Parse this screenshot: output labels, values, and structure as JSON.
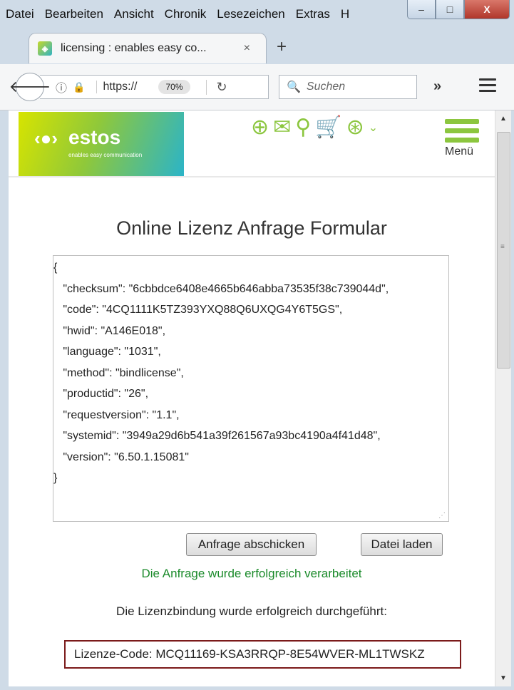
{
  "menubar": {
    "items": [
      "Datei",
      "Bearbeiten",
      "Ansicht",
      "Chronik",
      "Lesezeichen",
      "Extras",
      "H"
    ]
  },
  "window_controls": {
    "minimize": "–",
    "maximize": "□",
    "close": "X"
  },
  "tab": {
    "title": "licensing : enables easy co...",
    "close": "×",
    "favicon": "estos"
  },
  "newtab": "+",
  "navbar": {
    "url": "https://",
    "zoom": "70%",
    "search_placeholder": "Suchen",
    "overflow": "»"
  },
  "site": {
    "brand_name": "estos",
    "brand_tagline": "enables easy communication",
    "menu_label": "Menü",
    "icons": [
      "download-icon",
      "mail-icon",
      "search-icon",
      "cart-icon",
      "globe-icon"
    ],
    "accent_color": "#8cc63f"
  },
  "form": {
    "title": "Online Lizenz Anfrage Formular",
    "request_lines": [
      "{",
      "   \"checksum\": \"6cbbdce6408e4665b646abba73535f38c739044d\",",
      "   \"code\": \"4CQ1111K5TZ393YXQ88Q6UXQG4Y6T5GS\",",
      "   \"hwid\": \"A146E018\",",
      "   \"language\": \"1031\",",
      "   \"method\": \"bindlicense\",",
      "   \"productid\": \"26\",",
      "   \"requestversion\": \"1.1\",",
      "   \"systemid\": \"3949a29d6b541a39f261567a93bc4190a4f41d48\",",
      "   \"version\": \"6.50.1.15081\"",
      "}"
    ],
    "submit_label": "Anfrage abschicken",
    "load_label": "Datei laden",
    "success_message": "Die Anfrage wurde erfolgreich verarbeitet",
    "binding_message": "Die Lizenzbindung wurde erfolgreich durchgeführt:",
    "license_code": "Lizenze-Code: MCQ11169-KSA3RRQP-8E54WVER-ML1TWSKZ"
  }
}
